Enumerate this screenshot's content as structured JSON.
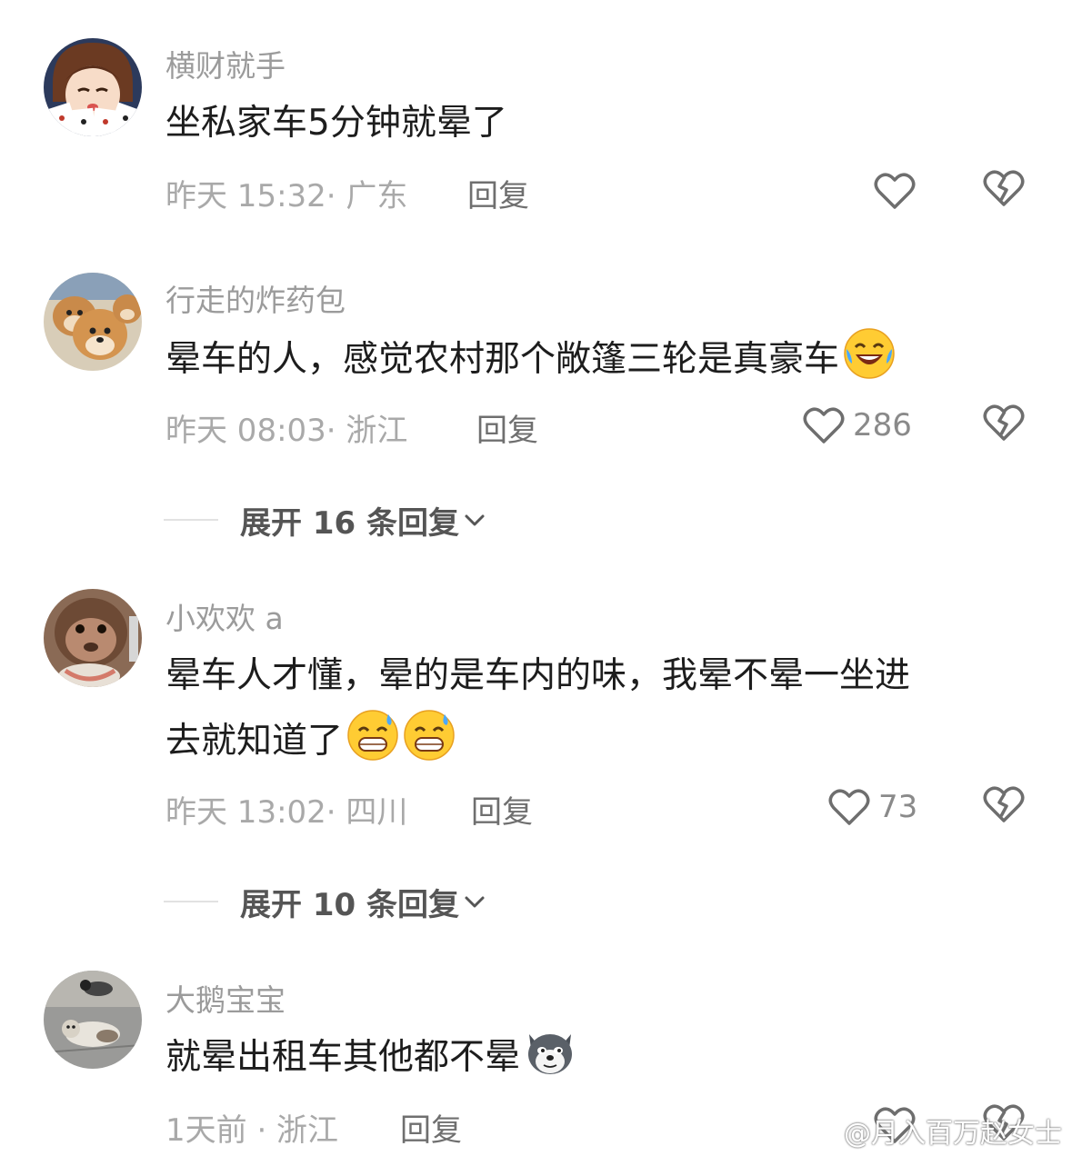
{
  "comments": [
    {
      "username": "横财就手",
      "text": "坐私家车5分钟就晕了",
      "meta": "昨天 15:32· 广东",
      "reply_label": "回复",
      "like_count": "",
      "avatar_icon": "anime-girl-with-cards-avatar",
      "emojis": []
    },
    {
      "username": "行走的炸药包",
      "text": "晕车的人，感觉农村那个敞篷三轮是真豪车",
      "meta": "昨天 08:03· 浙江",
      "reply_label": "回复",
      "like_count": "286",
      "avatar_icon": "shiba-dogs-avatar",
      "emojis": [
        "laughing-crying-emoji"
      ],
      "expand_label": "展开 16 条回复"
    },
    {
      "username": "小欢欢 a",
      "text_line1": "晕车人才懂，晕的是车内的味，我晕不晕一坐进",
      "text_line2": "去就知道了",
      "meta": "昨天 13:02· 四川",
      "reply_label": "回复",
      "like_count": "73",
      "avatar_icon": "monkey-face-avatar",
      "emojis": [
        "grinning-sweat-emoji",
        "grinning-sweat-emoji"
      ],
      "expand_label": "展开 10 条回复"
    },
    {
      "username": "大鹅宝宝",
      "text": "就晕出租车其他都不晕",
      "meta": "1天前 · 浙江",
      "reply_label": "回复",
      "like_count": "",
      "avatar_icon": "cat-on-street-avatar",
      "emojis": [
        "doge-emoji"
      ]
    }
  ],
  "watermark": "@月入百万赵女士",
  "colors": {
    "username": "#9b9b9b",
    "text": "#1d1d1d",
    "meta": "#a9a9a9",
    "icon_stroke": "#6e6e6e"
  }
}
